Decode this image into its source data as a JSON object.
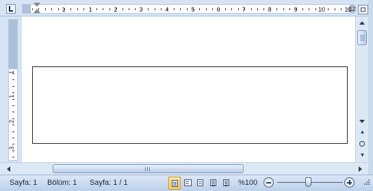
{
  "ruler": {
    "numbers": [
      "1",
      "1",
      "2",
      "3",
      "4",
      "5",
      "6",
      "7",
      "8",
      "9",
      "10",
      "11",
      "12"
    ],
    "vertical_numbers": [
      "1",
      "1",
      "2",
      "3"
    ]
  },
  "status": {
    "page": "Sayfa: 1",
    "section": "Bölüm: 1",
    "page_of": "Sayfa: 1 / 1",
    "zoom": "%100"
  },
  "colors": {
    "chrome": "#c9d9ee",
    "ruler_bg": "#d5e3f5",
    "page": "#ffffff",
    "active_view": "#f7c85a"
  },
  "icons": {
    "ruler_corner": "tab-stop-left-icon",
    "view_ruler": "view-ruler-icon",
    "prev_page": "double-chevron-up-icon",
    "browse": "select-browse-object-icon",
    "next_page": "double-chevron-down-icon",
    "zoom_out": "minus-icon",
    "zoom_in": "plus-icon"
  }
}
